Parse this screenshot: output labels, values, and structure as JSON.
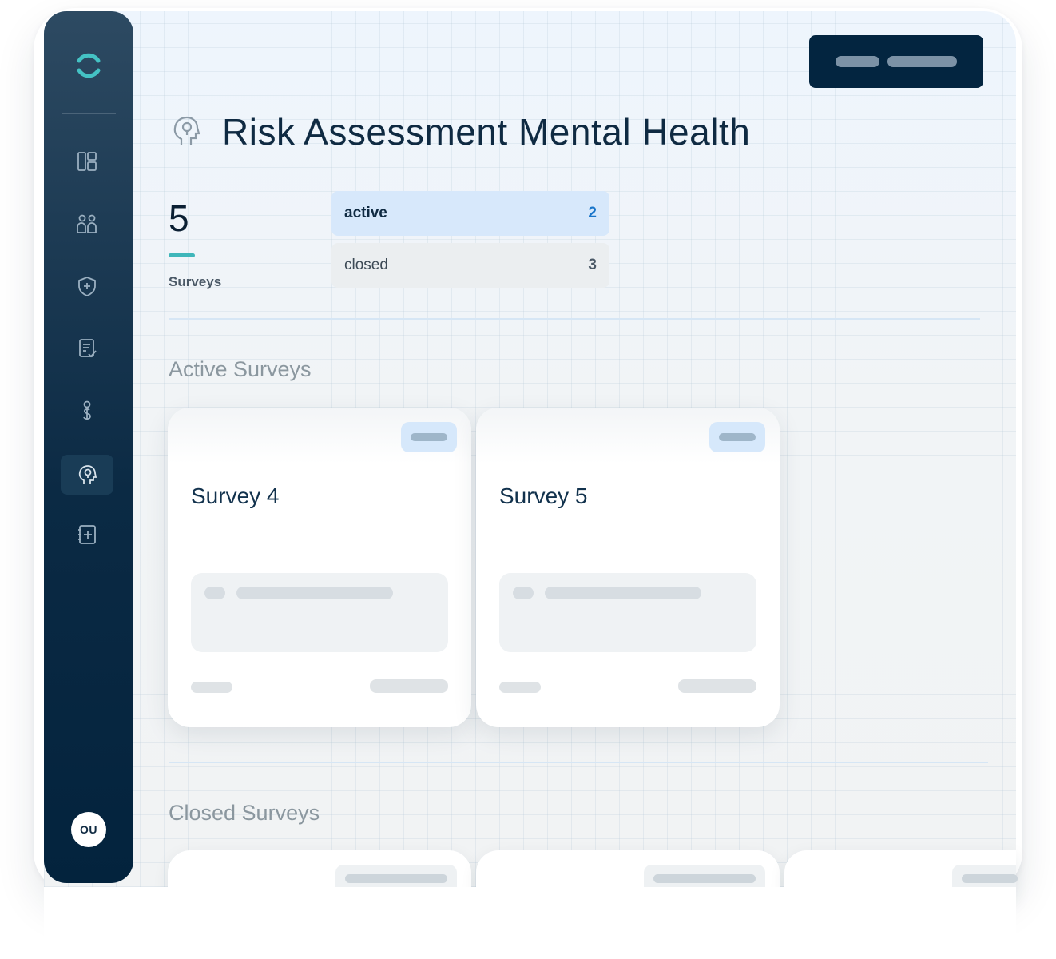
{
  "header": {
    "title": "Risk Assessment Mental Health",
    "page_icon": "head-icon"
  },
  "sidebar": {
    "logo": "logo-ring-icon",
    "items": [
      {
        "icon": "dashboard-icon",
        "active": false
      },
      {
        "icon": "users-icon",
        "active": false
      },
      {
        "icon": "shield-plus-icon",
        "active": false
      },
      {
        "icon": "clipboard-check-icon",
        "active": false
      },
      {
        "icon": "money-person-icon",
        "active": false
      },
      {
        "icon": "head-icon",
        "active": true
      },
      {
        "icon": "notebook-plus-icon",
        "active": false
      }
    ],
    "avatar_initials": "OU"
  },
  "summary": {
    "total": "5",
    "total_label": "Surveys",
    "statuses": [
      {
        "label": "active",
        "count": "2"
      },
      {
        "label": "closed",
        "count": "3"
      }
    ]
  },
  "sections": {
    "active_title": "Active Surveys",
    "closed_title": "Closed Surveys"
  },
  "active_surveys": [
    {
      "title": "Survey 4"
    },
    {
      "title": "Survey 5"
    }
  ],
  "colors": {
    "sidebar": "#0b2a44",
    "accent": "#3fb6ba",
    "active_status_bg": "#d7e8fb",
    "active_count": "#1975c9",
    "top_button": "#032540"
  }
}
